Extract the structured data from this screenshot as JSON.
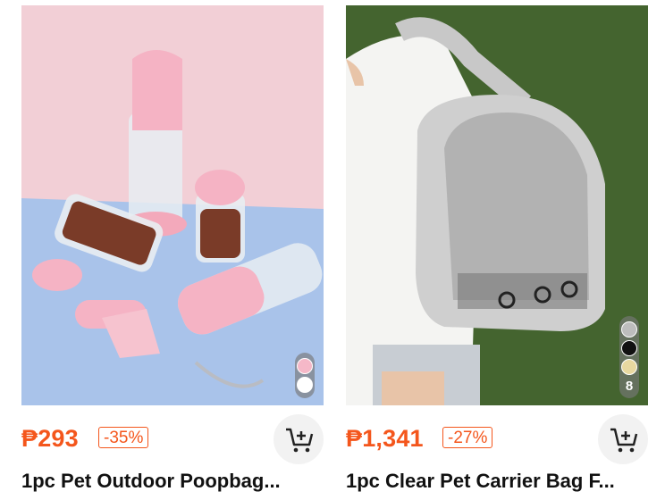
{
  "products": [
    {
      "price": "₱293",
      "discount": "-35%",
      "title": "1pc Pet Outdoor Poopbag...",
      "swatch_colors": [
        "#f5b8c8",
        "#ffffff"
      ]
    },
    {
      "price": "₱1,341",
      "discount": "-27%",
      "title": "1pc Clear Pet Carrier Bag F...",
      "swatch_colors": [
        "#bdbdbd",
        "#111111",
        "#e8d8a0"
      ],
      "more_count": "8"
    }
  ],
  "colors": {
    "accent": "#f4561c"
  },
  "icons": {
    "cart": "add-to-cart-icon"
  }
}
